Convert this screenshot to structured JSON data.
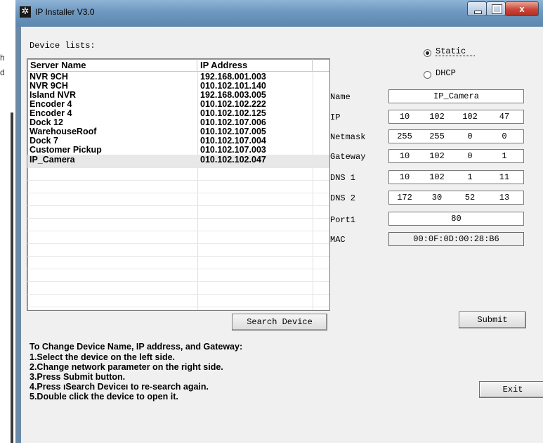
{
  "background_fragment": {
    "lines": [
      "h",
      "d"
    ]
  },
  "window": {
    "title": "IP Installer V3.0",
    "close_label": "x"
  },
  "device_list": {
    "label": "Device lists:",
    "columns": [
      "Server Name",
      "IP Address"
    ],
    "rows": [
      {
        "name": "NVR 9CH",
        "ip": "192.168.001.003"
      },
      {
        "name": "NVR 9CH",
        "ip": "010.102.101.140"
      },
      {
        "name": "Island NVR",
        "ip": "192.168.003.005"
      },
      {
        "name": "Encoder 4",
        "ip": "010.102.102.222"
      },
      {
        "name": "Encoder 4",
        "ip": "010.102.102.125"
      },
      {
        "name": "Dock 12",
        "ip": "010.102.107.006"
      },
      {
        "name": "WarehouseRoof",
        "ip": "010.102.107.005"
      },
      {
        "name": "Dock 7",
        "ip": "010.102.107.004"
      },
      {
        "name": "Customer Pickup",
        "ip": "010.102.107.003"
      },
      {
        "name": "IP_Camera",
        "ip": "010.102.102.047"
      }
    ],
    "selected_index": 9
  },
  "buttons": {
    "search": "Search Device",
    "submit": "Submit",
    "exit": "Exit"
  },
  "mode": {
    "static_label": "Static",
    "dhcp_label": "DHCP",
    "selected": "Static"
  },
  "config": {
    "name": {
      "label": "Name",
      "value": "IP_Camera"
    },
    "ip": {
      "label": "IP",
      "octets": [
        "10",
        "102",
        "102",
        "47"
      ]
    },
    "netmask": {
      "label": "Netmask",
      "octets": [
        "255",
        "255",
        "0",
        "0"
      ]
    },
    "gateway": {
      "label": "Gateway",
      "octets": [
        "10",
        "102",
        "0",
        "1"
      ]
    },
    "dns1": {
      "label": "DNS 1",
      "octets": [
        "10",
        "102",
        "1",
        "11"
      ]
    },
    "dns2": {
      "label": "DNS 2",
      "octets": [
        "172",
        "30",
        "52",
        "13"
      ]
    },
    "port1": {
      "label": "Port1",
      "value": "80"
    },
    "mac": {
      "label": "MAC",
      "value": "00:0F:0D:00:28:B6"
    }
  },
  "instructions": {
    "title": "To Change Device Name, IP address, and Gateway:",
    "steps": [
      "1.Select the device on the left side.",
      "2.Change network parameter on the right side.",
      "3.Press Submit button.",
      "4.Press ıSearch Deviceı to re-search again.",
      "5.Double click the device to open it."
    ]
  }
}
